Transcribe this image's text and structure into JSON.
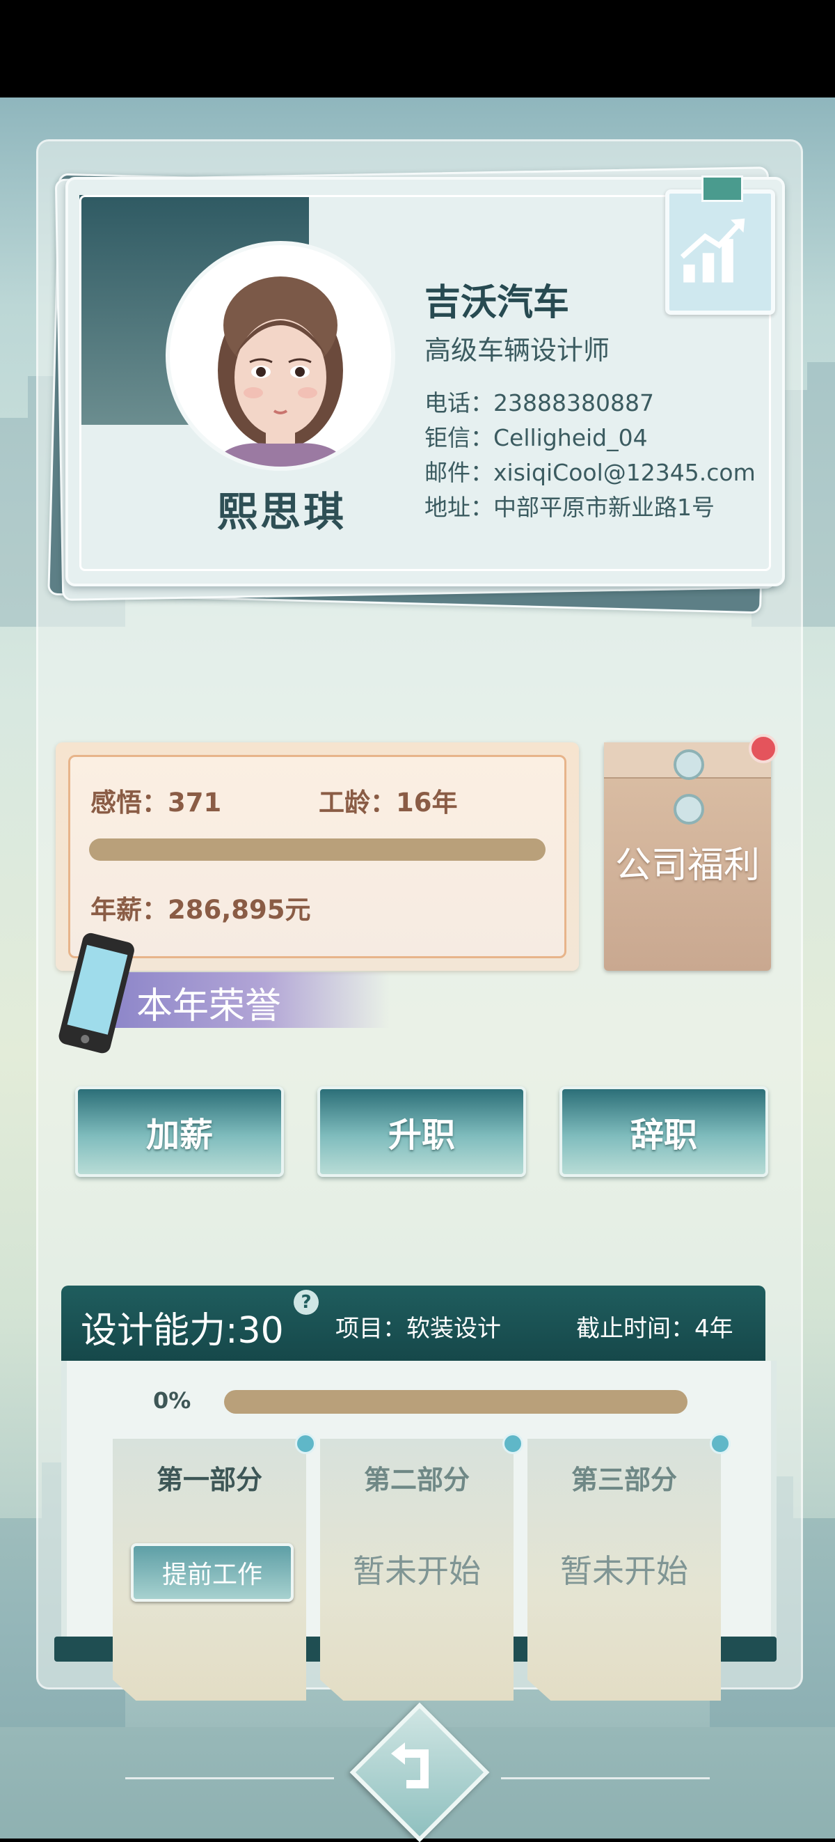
{
  "profile": {
    "name": "熙思琪",
    "company": "吉沃汽车",
    "job_title": "高级车辆设计师",
    "phone": "电话：23888380887",
    "chat_id": "钜信：Celligheid_04",
    "email": "邮件：xisiqiCool@12345.com",
    "address": "地址：中部平原市新业路1号",
    "icon": "growth-chart-clipboard-icon"
  },
  "stats": {
    "insight": "感悟：371",
    "seniority": "工龄：16年",
    "salary": "年薪：286,895元"
  },
  "welfare": {
    "label": "公司福利",
    "has_notification": true,
    "envelope_color": "#c9a890"
  },
  "honor": {
    "label": "本年荣誉",
    "icon": "phone-icon"
  },
  "actions": {
    "raise": "加薪",
    "promote": "升职",
    "resign": "辞职"
  },
  "project": {
    "ability": "设计能力:30",
    "help": "?",
    "name": "项目：软装设计",
    "deadline": "截止时间：4年",
    "progress": "0%",
    "progress_value": 0,
    "parts": [
      {
        "title": "第一部分",
        "action": "提前工作"
      },
      {
        "title": "第二部分",
        "status": "暂未开始"
      },
      {
        "title": "第三部分",
        "status": "暂未开始"
      }
    ]
  },
  "colors": {
    "accent_teal": "#1f5d5e",
    "bar_tan": "#b9a07a",
    "stat_brown": "#8a5c45",
    "notification_red": "#e4545c"
  },
  "nav": {
    "back_icon": "return-arrow-icon"
  }
}
